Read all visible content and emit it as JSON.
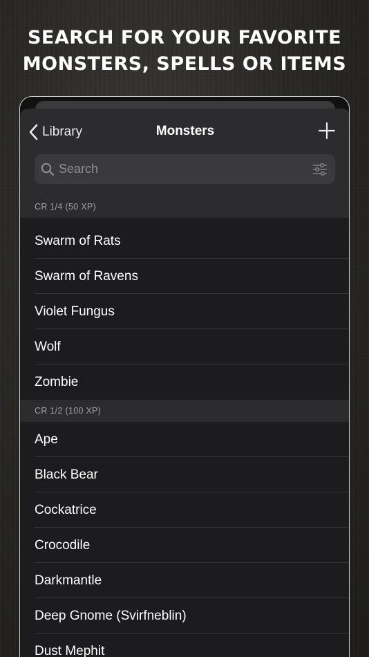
{
  "headline": {
    "line1": "SEARCH FOR YOUR FAVORITE",
    "line2": "MONSTERS, SPELLS OR ITEMS"
  },
  "nav": {
    "back_label": "Library",
    "title": "Monsters"
  },
  "search": {
    "placeholder": "Search",
    "value": ""
  },
  "sections": [
    {
      "header": "CR 1/4 (50 XP)",
      "items": [
        "Swarm of Rats",
        "Swarm of Ravens",
        "Violet Fungus",
        "Wolf",
        "Zombie"
      ]
    },
    {
      "header": "CR 1/2 (100 XP)",
      "items": [
        "Ape",
        "Black Bear",
        "Cockatrice",
        "Crocodile",
        "Darkmantle",
        "Deep Gnome (Svirfneblin)",
        "Dust Mephit"
      ]
    }
  ],
  "colors": {
    "background": "#2a2926",
    "sheet": "#1c1c1e",
    "nav_bar": "#2c2c2e",
    "search_field": "#3a3a3c",
    "section_header": "#2c2c2e",
    "separator": "#38383a",
    "secondary_text": "#8e8e93"
  },
  "icons": {
    "back": "chevron-left-icon",
    "add": "plus-icon",
    "search": "magnifying-glass-icon",
    "filter": "sliders-icon"
  }
}
